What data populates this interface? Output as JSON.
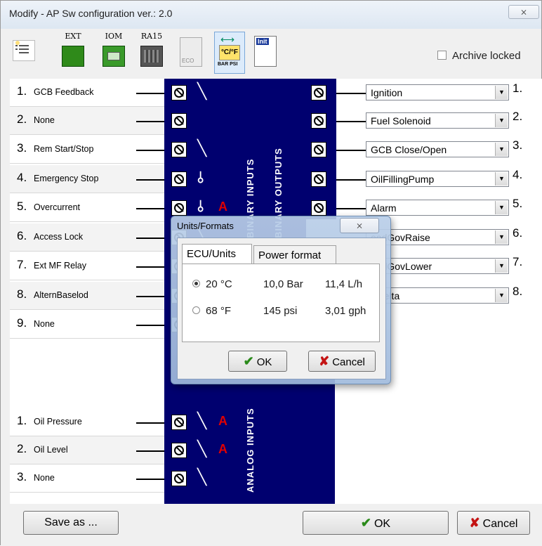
{
  "window": {
    "title": "Modify - AP  Sw configuration ver.: 2.0",
    "close_symbol": "⨯"
  },
  "toolbar": {
    "ext_label": "EXT",
    "iom_label": "IOM",
    "ra15_label": "RA15",
    "units_icon_text": "°C/°F",
    "units_icon_sub": "BAR PSI",
    "init_label": "Init",
    "eco_label": "ECO"
  },
  "archive": {
    "label": "Archive locked",
    "checked": false
  },
  "binary_inputs": {
    "section_label": "BINARY INPUTS",
    "rows": [
      {
        "num": "1.",
        "name": "GCB Feedback"
      },
      {
        "num": "2.",
        "name": "None"
      },
      {
        "num": "3.",
        "name": "Rem Start/Stop"
      },
      {
        "num": "4.",
        "name": "Emergency Stop"
      },
      {
        "num": "5.",
        "name": "Overcurrent"
      },
      {
        "num": "6.",
        "name": "Access Lock"
      },
      {
        "num": "7.",
        "name": "Ext MF Relay"
      },
      {
        "num": "8.",
        "name": "AlternBaselod"
      },
      {
        "num": "9.",
        "name": "None"
      }
    ]
  },
  "binary_outputs": {
    "section_label": "BINARY OUTPUTS",
    "rows": [
      {
        "num": "1.",
        "value": "Ignition"
      },
      {
        "num": "2.",
        "value": "Fuel Solenoid"
      },
      {
        "num": "3.",
        "value": "GCB Close/Open"
      },
      {
        "num": "4.",
        "value": "OilFillingPump"
      },
      {
        "num": "5.",
        "value": "Alarm"
      },
      {
        "num": "6.",
        "value": "eedGovRaise"
      },
      {
        "num": "7.",
        "value": "eedGovLower"
      },
      {
        "num": "8.",
        "value": "r/Delta"
      }
    ]
  },
  "analog_inputs": {
    "section_label": "ANALOG INPUTS",
    "rows": [
      {
        "num": "1.",
        "name": "Oil Pressure"
      },
      {
        "num": "2.",
        "name": "Oil Level"
      },
      {
        "num": "3.",
        "name": "None"
      }
    ],
    "alarm_letter": "A"
  },
  "footer": {
    "save_as": "Save as ...",
    "ok": "OK",
    "cancel": "Cancel"
  },
  "units_dialog": {
    "title": "Units/Formats",
    "close_symbol": "⨯",
    "tabs": [
      "ECU/Units",
      "Power format"
    ],
    "options": [
      {
        "temp": "20 °C",
        "pressure": "10,0 Bar",
        "flow": "11,4 L/h",
        "selected": true
      },
      {
        "temp": "68 °F",
        "pressure": "145 psi",
        "flow": "3,01 gph",
        "selected": false
      }
    ],
    "ok": "OK",
    "cancel": "Cancel"
  },
  "colors": {
    "panel_blue": "#00006f",
    "alarm_red": "#e00000",
    "ok_green": "#2a8a1a",
    "cancel_red": "#c41414"
  }
}
